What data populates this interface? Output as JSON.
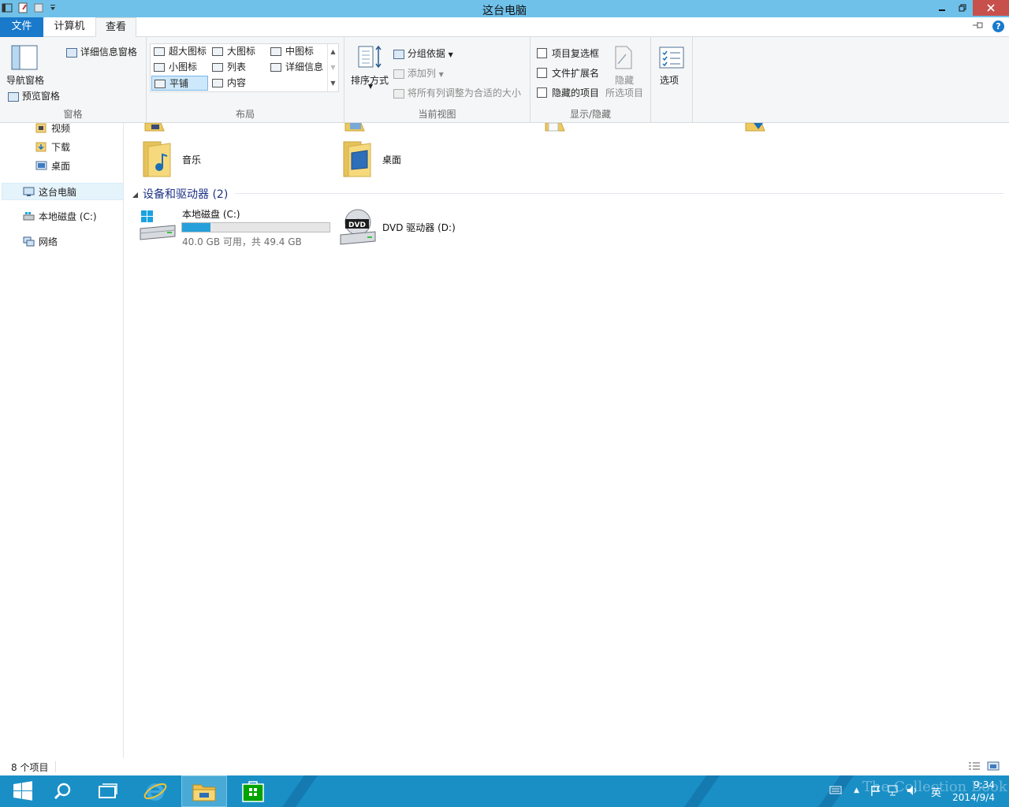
{
  "window": {
    "title": "这台电脑"
  },
  "ribbon_tabs": {
    "file": "文件",
    "computer": "计算机",
    "view": "查看"
  },
  "ribbon": {
    "panes": {
      "label": "窗格",
      "nav_pane": "导航窗格",
      "preview_pane": "预览窗格",
      "details_pane": "详细信息窗格"
    },
    "layout": {
      "label": "布局",
      "items": [
        "超大图标",
        "大图标",
        "中图标",
        "小图标",
        "列表",
        "详细信息",
        "平铺",
        "内容"
      ],
      "selected": "平铺"
    },
    "current_view": {
      "label": "当前视图",
      "sort_by": "排序方式",
      "group_by": "分组依据",
      "add_column": "添加列",
      "fit_columns": "将所有列调整为合适的大小"
    },
    "show_hide": {
      "label": "显示/隐藏",
      "item_checkboxes": "项目复选框",
      "file_extensions": "文件扩展名",
      "hidden_items": "隐藏的项目",
      "hide_selected_line1": "隐藏",
      "hide_selected_line2": "所选项目"
    },
    "options": "选项"
  },
  "nav": {
    "videos": "视频",
    "downloads": "下载",
    "desktop": "桌面",
    "this_pc": "这台电脑",
    "local_disk": "本地磁盘 (C:)",
    "network": "网络"
  },
  "content": {
    "folders": [
      {
        "label": "音乐",
        "icon": "music-folder-icon"
      },
      {
        "label": "桌面",
        "icon": "desktop-folder-icon"
      }
    ],
    "devices_header": "设备和驱动器 (2)",
    "drives": [
      {
        "label": "本地磁盘 (C:)",
        "space": "40.0 GB 可用，共 49.4 GB",
        "used_fraction": 0.19
      },
      {
        "label": "DVD 驱动器 (D:)",
        "badge": "DVD"
      }
    ]
  },
  "statusbar": {
    "count": "8 个项目"
  },
  "taskbar": {
    "clock_time": "9:34",
    "clock_date": "2014/9/4",
    "ime": "英",
    "watermark": "The Collection Book"
  },
  "colors": {
    "titlebar": "#6fc1ea",
    "accent": "#1979ca",
    "taskbar": "#1a8fc6",
    "drive_fill": "#26a0da"
  }
}
